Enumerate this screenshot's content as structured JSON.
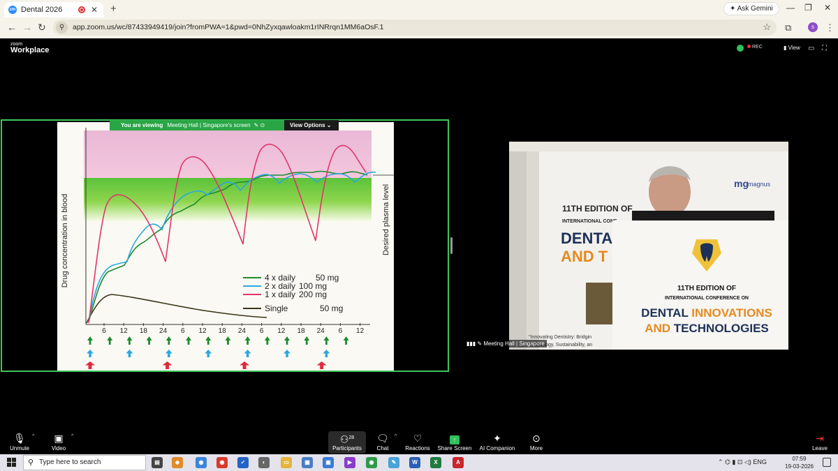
{
  "browser": {
    "tab_title": "Dental 2026",
    "tab_favicon": "zoom",
    "new_tab": "+",
    "ask_gemini": "Ask Gemini",
    "url": "app.zoom.us/wc/87433949419/join?fromPWA=1&pwd=0NhZyxqawloakm1rINRrqn1MM6aOsF.1",
    "profile_initial": "s"
  },
  "zoom": {
    "logo_small": "zoom",
    "logo_big": "Workplace",
    "rec": "REC",
    "view": "View",
    "banner_viewing": "You are viewing",
    "banner_who": "Meeting Hall | Singapore's screen",
    "view_options": "View Options",
    "video_name": "Meeting Hall | Singapore"
  },
  "slide": {
    "y_label": "Drug concentration in blood",
    "right_label": "Desired plasma level",
    "legend": [
      {
        "label": "4 x daily",
        "dose": "50 mg",
        "color": "#1e8a2e"
      },
      {
        "label": "2 x daily",
        "dose": "100 mg",
        "color": "#2aa8e0"
      },
      {
        "label": "1 x daily",
        "dose": "200 mg",
        "color": "#e0356b"
      },
      {
        "label": "Single",
        "dose": "50 mg",
        "color": "#3a3418"
      }
    ],
    "x_ticks": [
      "6",
      "12",
      "18",
      "24",
      "6",
      "12",
      "18",
      "24",
      "6",
      "12",
      "18",
      "24",
      "6",
      "12"
    ]
  },
  "conference": {
    "brand": "magnus",
    "edition_left": "11TH EDITION OF",
    "intl_left": "INTERNATIONAL CONF",
    "dental_left": "DENTA",
    "and_left": "AND T",
    "edition": "11TH EDITION OF",
    "intl": "INTERNATIONAL CONFERENCE ON",
    "title1_dark": "DENTAL ",
    "title1_orange": "INNOVATIONS",
    "title2_orange": "AND ",
    "title2_dark": "TECHNOLOGIES",
    "tagline1": "\"Innovating Dentistry: Bridgin",
    "tagline2": "Technology, Sustainability, an"
  },
  "toolbar": {
    "unmute": "Unmute",
    "video": "Video",
    "participants": "Participants",
    "participants_count": "28",
    "chat": "Chat",
    "reactions": "Reactions",
    "share_screen": "Share Screen",
    "ai_companion": "AI Companion",
    "more": "More",
    "leave": "Leave"
  },
  "taskbar": {
    "search_placeholder": "Type here to search",
    "lang": "ENG",
    "time": "07:59",
    "date": "19-03-2026"
  }
}
